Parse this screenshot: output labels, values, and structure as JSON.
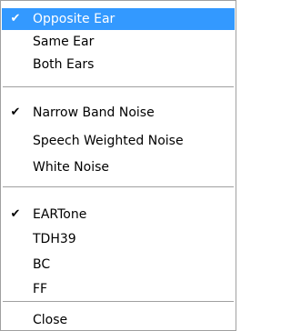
{
  "menu": {
    "groups": [
      {
        "items": [
          {
            "label": "Opposite Ear",
            "checked": true,
            "selected": true
          },
          {
            "label": "Same Ear",
            "checked": false
          },
          {
            "label": "Both Ears",
            "checked": false
          }
        ]
      },
      {
        "items": [
          {
            "label": "Narrow Band Noise",
            "checked": true
          },
          {
            "label": "Speech Weighted Noise",
            "checked": false
          },
          {
            "label": "White Noise",
            "checked": false
          }
        ]
      },
      {
        "items": [
          {
            "label": "EARTone",
            "checked": true
          },
          {
            "label": "TDH39",
            "checked": false
          },
          {
            "label": "BC",
            "checked": false
          },
          {
            "label": "FF",
            "checked": false
          }
        ]
      },
      {
        "items": [
          {
            "label": "Close",
            "checked": false
          }
        ]
      }
    ],
    "check_glyph": "✔",
    "colors": {
      "highlight": "#3399ff",
      "highlight_text": "#ffffff",
      "separator": "#a0a0a0"
    }
  }
}
